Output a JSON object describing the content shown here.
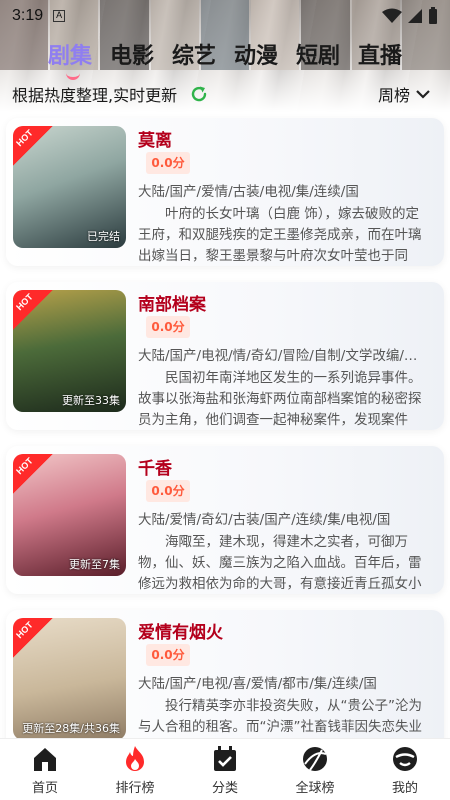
{
  "status_bar": {
    "time": "3:19",
    "notif_letter": "A"
  },
  "tabs": [
    {
      "label": "剧集",
      "active": true
    },
    {
      "label": "电影",
      "active": false
    },
    {
      "label": "综艺",
      "active": false
    },
    {
      "label": "动漫",
      "active": false
    },
    {
      "label": "短剧",
      "active": false
    },
    {
      "label": "直播",
      "active": false
    }
  ],
  "sub_header": {
    "description": "根据热度整理,实时更新",
    "rank_select": "周榜"
  },
  "items": [
    {
      "title": "莫离",
      "score": "0.0分",
      "tags": "大陆/国产/爱情/古装/电视/集/连续/国",
      "synopsis": "叶府的长女叶璃（白鹿 饰），嫁去破败的定王府，和双腿残疾的定王墨修尧成亲，而在叶璃出嫁当日，黎王墨景黎与叶府次女叶莹也于同日…",
      "badge": "HOT",
      "progress": "已完结",
      "poster_colors": [
        "#2b3b3e",
        "#8fa6a1",
        "#c9d6cf"
      ]
    },
    {
      "title": "南部档案",
      "score": "0.0分",
      "tags": "大陆/国产/电视/情/奇幻/冒险/自制/文学改编/…",
      "synopsis": "民国初年南洋地区发生的一系列诡异事件。故事以张海盐和张海虾两位南部档案馆的秘密探员为主角，他们调查一起神秘案件，发现案件背…",
      "badge": "HOT",
      "progress": "更新至33集",
      "poster_colors": [
        "#1d2a1c",
        "#4c6b3a",
        "#b7a14a"
      ]
    },
    {
      "title": "千香",
      "score": "0.0分",
      "tags": "大陆/爱情/奇幻/古装/国产/连续/集/电视/国",
      "synopsis": "海陬至，建木现，得建木之实者，可御万物，仙、妖、魔三族为之陷入血战。百年后，雷修远为救相依为命的大哥，有意接近青丘孤女小棒…",
      "badge": "HOT",
      "progress": "更新至7集",
      "poster_colors": [
        "#5a1e2a",
        "#d07a8a",
        "#f2c7c8"
      ]
    },
    {
      "title": "爱情有烟火",
      "score": "0.0分",
      "tags": "大陆/国产/电视/喜/爱情/都市/集/连续/国",
      "synopsis": "投行精英李亦非投资失败，从“贵公子”沦为与人合租的租客。而“沪漂”社畜钱菲因失恋失业双重打击，为减轻房贷压力开始招租，就这样，俊杨",
      "badge": "HOT",
      "progress": "更新至28集/共36集",
      "poster_colors": [
        "#e8dcc8",
        "#c9b79a",
        "#8f7c65"
      ]
    }
  ],
  "bottom_nav": [
    {
      "label": "首页",
      "icon": "home-icon"
    },
    {
      "label": "排行榜",
      "icon": "flame-icon"
    },
    {
      "label": "分类",
      "icon": "calendar-check-icon"
    },
    {
      "label": "全球榜",
      "icon": "globe-icon"
    },
    {
      "label": "我的",
      "icon": "profile-icon"
    }
  ],
  "colors": {
    "title_red": "#b4001c",
    "score_orange": "#ff5a3c",
    "active_tab": "#8f7ef0",
    "hot_red": "#ff2a2a",
    "refresh_green": "#2fb34a"
  }
}
